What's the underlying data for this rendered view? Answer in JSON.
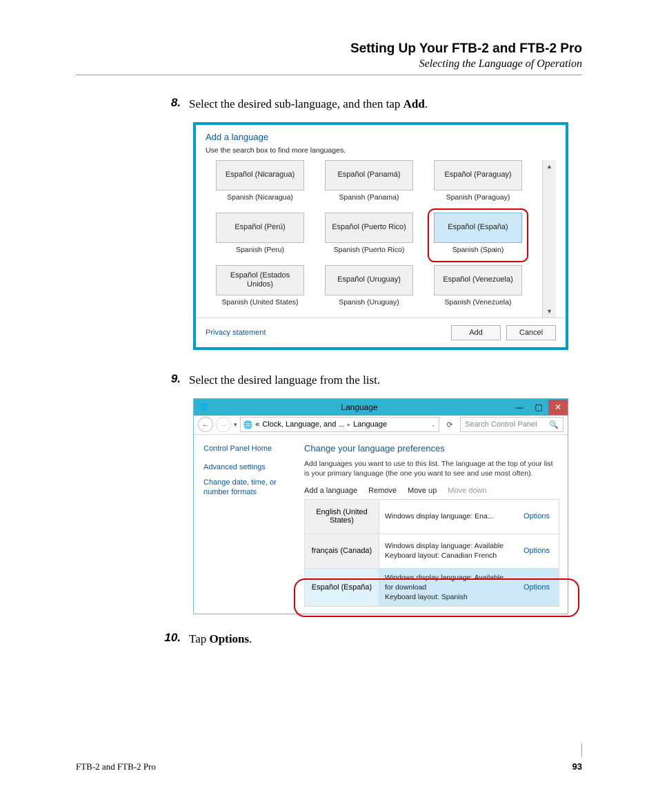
{
  "header": {
    "title": "Setting Up Your FTB-2 and FTB-2 Pro",
    "subtitle": "Selecting the Language of Operation"
  },
  "steps": {
    "s8": {
      "num": "8.",
      "text_a": "Select the desired sub-language, and then tap ",
      "bold": "Add",
      "text_b": "."
    },
    "s9": {
      "num": "9.",
      "text": "Select the desired language from the list."
    },
    "s10": {
      "num": "10.",
      "text_a": "Tap ",
      "bold": "Options",
      "text_b": "."
    }
  },
  "shot1": {
    "title": "Add a language",
    "help": "Use the search box to find more languages.",
    "rows": [
      [
        {
          "native": "Español (Nicaragua)",
          "eng": "Spanish (Nicaragua)"
        },
        {
          "native": "Español (Panamá)",
          "eng": "Spanish (Panama)"
        },
        {
          "native": "Español (Paraguay)",
          "eng": "Spanish (Paraguay)"
        }
      ],
      [
        {
          "native": "Español (Perú)",
          "eng": "Spanish (Peru)"
        },
        {
          "native": "Español (Puerto Rico)",
          "eng": "Spanish (Puerto Rico)"
        },
        {
          "native": "Español (España)",
          "eng": "Spanish (Spain)",
          "selected": true
        }
      ],
      [
        {
          "native": "Español (Estados Unidos)",
          "eng": "Spanish (United States)"
        },
        {
          "native": "Español (Uruguay)",
          "eng": "Spanish (Uruguay)"
        },
        {
          "native": "Español (Venezuela)",
          "eng": "Spanish (Venezuela)"
        }
      ]
    ],
    "privacy": "Privacy statement",
    "add": "Add",
    "cancel": "Cancel"
  },
  "shot2": {
    "window_title": "Language",
    "breadcrumb": {
      "a": "Clock, Language, and ...",
      "b": "Language"
    },
    "search_placeholder": "Search Control Panel",
    "sidebar": {
      "home": "Control Panel Home",
      "adv": "Advanced settings",
      "date": "Change date, time, or number formats"
    },
    "main_title": "Change your language preferences",
    "main_help": "Add languages you want to use to this list. The language at the top of your list is your primary language (the one you want to see and use most often).",
    "toolbar": {
      "add": "Add a language",
      "remove": "Remove",
      "up": "Move up",
      "down": "Move down"
    },
    "rows": [
      {
        "name": "English (United States)",
        "desc": "Windows display language: Ena...",
        "opt": "Options"
      },
      {
        "name": "français (Canada)",
        "desc": "Windows display language: Available\nKeyboard layout: Canadian French",
        "opt": "Options"
      },
      {
        "name": "Español (España)",
        "desc": "Windows display language: Available for download\nKeyboard layout: Spanish",
        "opt": "Options",
        "selected": true
      }
    ]
  },
  "footer": {
    "left": "FTB-2 and FTB-2 Pro",
    "right": "93"
  }
}
